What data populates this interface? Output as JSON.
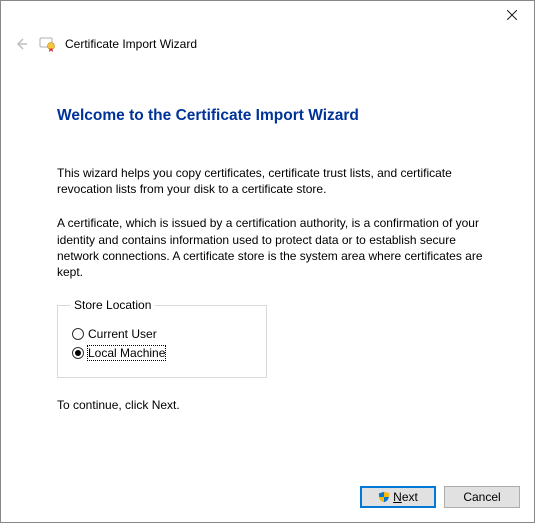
{
  "header": {
    "title": "Certificate Import Wizard"
  },
  "main": {
    "heading": "Welcome to the Certificate Import Wizard",
    "para1": "This wizard helps you copy certificates, certificate trust lists, and certificate revocation lists from your disk to a certificate store.",
    "para2": "A certificate, which is issued by a certification authority, is a confirmation of your identity and contains information used to protect data or to establish secure network connections. A certificate store is the system area where certificates are kept.",
    "storeLocation": {
      "legend": "Store Location",
      "options": [
        {
          "label": "Current User",
          "selected": false
        },
        {
          "label": "Local Machine",
          "selected": true
        }
      ]
    },
    "continueText": "To continue, click Next."
  },
  "footer": {
    "next": "Next",
    "cancel": "Cancel"
  }
}
